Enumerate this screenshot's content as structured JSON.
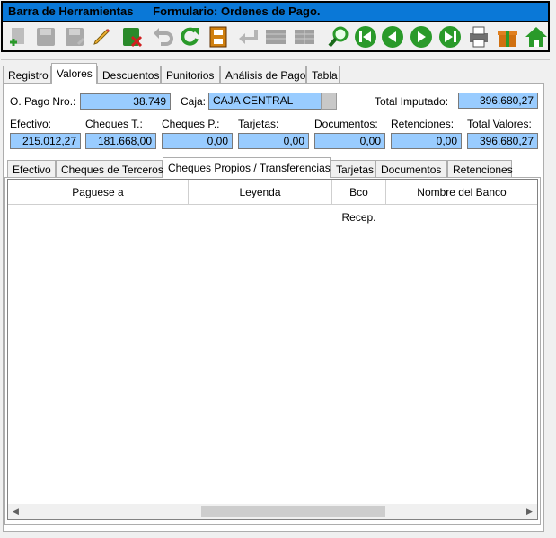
{
  "window": {
    "title": "Barra de Herramientas      Formulario: Ordenes de Pago."
  },
  "toolbar": [
    {
      "name": "new-icon",
      "color": "#9a9a9a"
    },
    {
      "name": "save-icon",
      "color": "#9a9a9a"
    },
    {
      "name": "save-as-icon",
      "color": "#9a9a9a"
    },
    {
      "name": "edit-pencil-icon",
      "color": "#e0a020"
    },
    {
      "name": "delete-icon",
      "color": "#2a8a2a"
    },
    {
      "name": "undo-icon",
      "color": "#9a9a9a"
    },
    {
      "name": "refresh-icon",
      "color": "#2a9a2a"
    },
    {
      "name": "film-icon",
      "color": "#c07010"
    },
    {
      "name": "enter-icon",
      "color": "#9a9a9a"
    },
    {
      "name": "grid-icon",
      "color": "#9a9a9a"
    },
    {
      "name": "grid-alt-icon",
      "color": "#9a9a9a"
    },
    {
      "name": "search-icon",
      "color": "#2a9a2a"
    },
    {
      "name": "first-record-icon",
      "color": "#2a9a2a"
    },
    {
      "name": "previous-record-icon",
      "color": "#2a9a2a"
    },
    {
      "name": "next-record-icon",
      "color": "#2a9a2a"
    },
    {
      "name": "last-record-icon",
      "color": "#2a9a2a"
    },
    {
      "name": "printer-icon",
      "color": "#606060"
    },
    {
      "name": "gift-icon",
      "color": "#d07010"
    },
    {
      "name": "home-icon",
      "color": "#2a9a2a"
    }
  ],
  "main_tabs": [
    "Registro",
    "Valores",
    "Descuentos",
    "Punitorios",
    "Análisis de Pago",
    "Tabla"
  ],
  "main_tab_active": "Valores",
  "header_fields": {
    "opago_label": "O. Pago Nro.:",
    "opago_value": "38.749",
    "caja_label": "Caja:",
    "caja_value": "CAJA CENTRAL",
    "total_imputado_label": "Total Imputado:",
    "total_imputado_value": "396.680,27"
  },
  "totals": [
    {
      "label": "Efectivo:",
      "value": "215.012,27"
    },
    {
      "label": "Cheques T.:",
      "value": "181.668,00"
    },
    {
      "label": "Cheques P.:",
      "value": "0,00"
    },
    {
      "label": "Tarjetas:",
      "value": "0,00"
    },
    {
      "label": "Documentos:",
      "value": "0,00"
    },
    {
      "label": "Retenciones:",
      "value": "0,00"
    },
    {
      "label": "Total Valores:",
      "value": "396.680,27"
    }
  ],
  "sub_tabs": [
    "Efectivo",
    "Cheques de Terceros",
    "Cheques Propios / Transferencias",
    "Tarjetas",
    "Documentos",
    "Retenciones"
  ],
  "sub_tab_active": "Cheques Propios / Transferencias",
  "grid": {
    "columns": [
      "Paguese a",
      "Leyenda",
      "Bco Recep.",
      "Nombre del Banco"
    ]
  },
  "colors": {
    "title_bar": "#0a78d7",
    "field_bg": "#99ccff"
  }
}
